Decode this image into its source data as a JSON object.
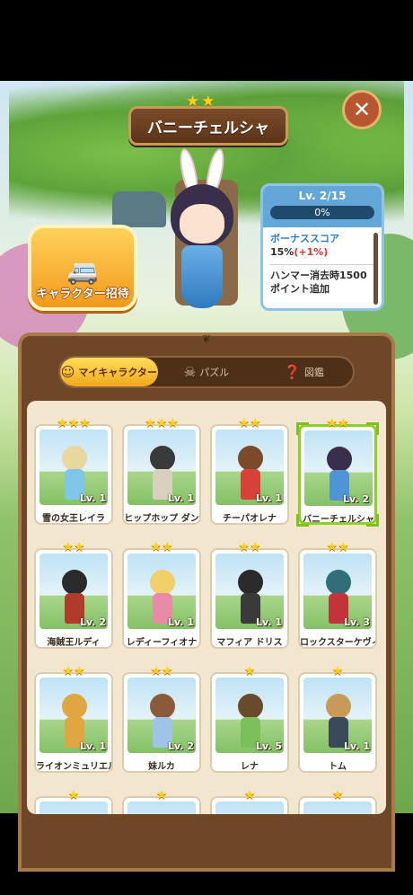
{
  "title": {
    "name": "バニーチェルシャ",
    "stars": 2
  },
  "close_icon": "close-icon",
  "invite": {
    "label": "キャラクター招待",
    "icon": "van-icon"
  },
  "level": {
    "text": "Lv. 2/15",
    "progress_label": "0%",
    "progress": 0,
    "bonus_title": "ボーナススコア",
    "bonus_value": "15%",
    "bonus_plus": "(+1%)",
    "desc": "ハンマー消去時1500ポイント追加"
  },
  "tabs": [
    {
      "label": "マイキャラクター",
      "icon": "avatar-icon",
      "active": true
    },
    {
      "label": "パズル",
      "icon": "skull-icon",
      "active": false
    },
    {
      "label": "図鑑",
      "icon": "book-icon",
      "active": false
    }
  ],
  "cards": [
    {
      "name": "雪の女王レイラ",
      "lv": "Lv. 1",
      "stars": 3,
      "hair": "#e9d7a0",
      "outfit": "#7fc6e8"
    },
    {
      "name": "ヒップホップ ダン",
      "lv": "Lv. 1",
      "stars": 3,
      "hair": "#3a3a3a",
      "outfit": "#d9d0be"
    },
    {
      "name": "チーパオレナ",
      "lv": "Lv. 1",
      "stars": 2,
      "hair": "#7a4a2a",
      "outfit": "#d8413a"
    },
    {
      "name": "バニーチェルシャ",
      "lv": "Lv. 2",
      "stars": 2,
      "hair": "#3a2f4a",
      "outfit": "#4f95d6",
      "selected": true
    },
    {
      "name": "海賊王ルディ",
      "lv": "Lv. 2",
      "stars": 2,
      "hair": "#2a2a2a",
      "outfit": "#b03b2c"
    },
    {
      "name": "レディーフィオナ",
      "lv": "Lv. 1",
      "stars": 2,
      "hair": "#f1cf6a",
      "outfit": "#e98aa6"
    },
    {
      "name": "マフィア ドリス",
      "lv": "Lv. 1",
      "stars": 2,
      "hair": "#2b2b2b",
      "outfit": "#3a3a3a"
    },
    {
      "name": "ロックスターケヴィン",
      "lv": "Lv. 3",
      "stars": 2,
      "hair": "#2f6f7a",
      "outfit": "#c2343a"
    },
    {
      "name": "ライオンミュリエル",
      "lv": "Lv. 1",
      "stars": 2,
      "hair": "#e0a640",
      "outfit": "#e0a640"
    },
    {
      "name": "妹ルカ",
      "lv": "Lv. 2",
      "stars": 2,
      "hair": "#8a5a3a",
      "outfit": "#9fc4e8"
    },
    {
      "name": "レナ",
      "lv": "Lv. 5",
      "stars": 1,
      "hair": "#6a4a2a",
      "outfit": "#7bbf5a"
    },
    {
      "name": "トム",
      "lv": "Lv. 1",
      "stars": 1,
      "hair": "#c79a5a",
      "outfit": "#3a4a5a"
    },
    {
      "name": "",
      "lv": "",
      "stars": 1,
      "hair": "#c0c0c0",
      "outfit": "#c0c0c0"
    },
    {
      "name": "",
      "lv": "",
      "stars": 1,
      "hair": "#c0c0c0",
      "outfit": "#c0c0c0"
    },
    {
      "name": "",
      "lv": "",
      "stars": 1,
      "hair": "#c0c0c0",
      "outfit": "#c0c0c0"
    },
    {
      "name": "",
      "lv": "",
      "stars": 1,
      "hair": "#c0c0c0",
      "outfit": "#c0c0c0"
    }
  ],
  "colors": {
    "accent": "#f0a91c",
    "wood": "#6e4628",
    "selected": "#8ed02a"
  }
}
